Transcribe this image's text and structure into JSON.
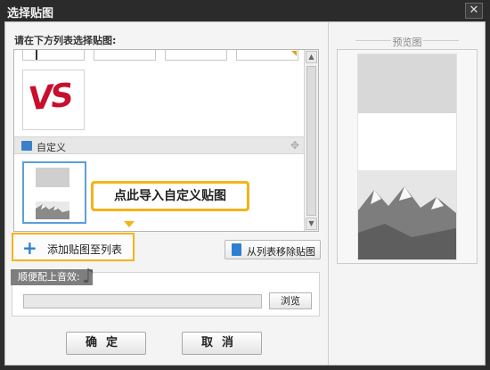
{
  "window": {
    "title": "选择贴图",
    "close_glyph": "✕"
  },
  "list": {
    "instruction": "请在下方列表选择贴图:",
    "vs_text": "VS",
    "section_title": "自定义",
    "move_glyph": "✥"
  },
  "tooltip": {
    "text": "点此导入自定义贴图"
  },
  "buttons": {
    "add_label": "添加贴图至列表",
    "add_glyph": "+",
    "remove_label": "从列表移除贴图",
    "browse_label": "浏览",
    "ok_label": "确定",
    "cancel_label": "取消"
  },
  "sound": {
    "label": "顺便配上音效:",
    "note_glyph": "♪",
    "value": ""
  },
  "preview": {
    "title": "预览图"
  },
  "colors": {
    "accent": "#f5b318",
    "blue": "#2f7fd0",
    "vs_red": "#c8102e"
  },
  "icons": [
    "close-icon",
    "picture-icon",
    "move-icon",
    "plus-icon",
    "trash-icon",
    "music-note-icon"
  ]
}
